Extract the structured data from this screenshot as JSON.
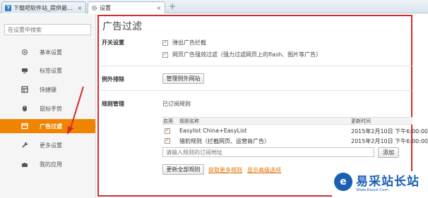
{
  "tabs": [
    {
      "label": "下载吧软件站_提供最…",
      "close": "×"
    },
    {
      "label": "设置",
      "close": "×"
    }
  ],
  "new_tab": "+",
  "sidebar": {
    "search_placeholder": "在设置中搜索",
    "items": [
      {
        "label": "基本设置",
        "icon": "gear-icon"
      },
      {
        "label": "标签设置",
        "icon": "monitor-icon"
      },
      {
        "label": "快捷键",
        "icon": "grid-icon"
      },
      {
        "label": "鼠标手势",
        "icon": "mouse-icon"
      },
      {
        "label": "广告过滤",
        "icon": "window-icon",
        "active": true
      },
      {
        "label": "更多设置",
        "icon": "wrench-icon"
      },
      {
        "label": "我的应用",
        "icon": "puzzle-icon"
      }
    ]
  },
  "main": {
    "title": "广告过滤",
    "switch_section": {
      "label": "开关设置",
      "options": [
        {
          "label": "弹出广告拦截",
          "checked": true
        },
        {
          "label": "网页广告强效过滤（强力过滤网页上的flash、图片等广告）",
          "checked": true
        }
      ]
    },
    "exception_section": {
      "label": "例外排除",
      "button": "管理例外网站"
    },
    "rules_section": {
      "label": "规则管理",
      "subscribed_label": "已订阅规则",
      "columns": [
        "启用",
        "规则名称",
        "更新时间"
      ],
      "rows": [
        {
          "enabled": true,
          "name": "Easylist China+EasyList",
          "updated": "2015年2月10日 下午6:00:00"
        },
        {
          "enabled": true,
          "name": "猎豹规则（拦截网页、运营商广告）",
          "updated": "2015年2月10日 下午6:00:00"
        }
      ],
      "input_placeholder": "请输入规则的订阅地址",
      "add_button": "添加",
      "update_all_button": "更新全部规则",
      "more_rules_link": "获取更多规则",
      "advanced_link": "显示高级选项"
    }
  },
  "watermark": {
    "text": "易采站长站",
    "sub": "Www.Easck.Com"
  },
  "colors": {
    "accent": "#f08300",
    "annotation_red": "#d42b2b",
    "watermark_blue": "#1a5fb4"
  }
}
